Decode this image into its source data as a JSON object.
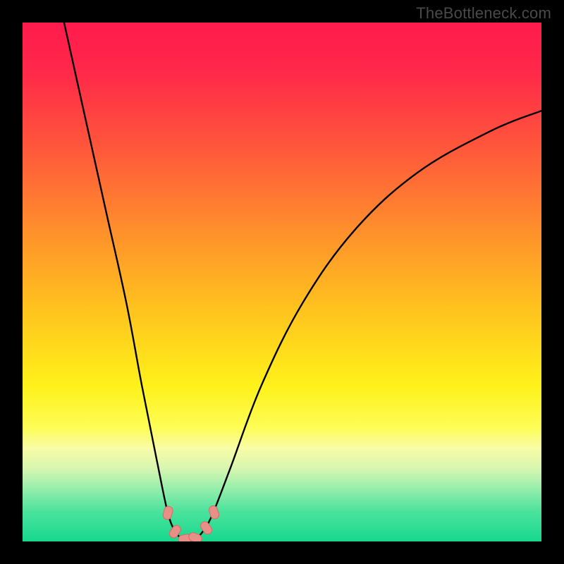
{
  "watermark": "TheBottleneck.com",
  "colors": {
    "frame": "#000000",
    "gradient_stops": [
      {
        "offset": 0.0,
        "color": "#ff1a4d"
      },
      {
        "offset": 0.1,
        "color": "#ff2a49"
      },
      {
        "offset": 0.25,
        "color": "#ff5a3a"
      },
      {
        "offset": 0.4,
        "color": "#ff8f2c"
      },
      {
        "offset": 0.55,
        "color": "#ffc21e"
      },
      {
        "offset": 0.7,
        "color": "#fff11a"
      },
      {
        "offset": 0.78,
        "color": "#fdfd55"
      },
      {
        "offset": 0.82,
        "color": "#f9fca6"
      },
      {
        "offset": 0.86,
        "color": "#d6f6b0"
      },
      {
        "offset": 0.9,
        "color": "#93edab"
      },
      {
        "offset": 0.94,
        "color": "#4ee39d"
      },
      {
        "offset": 1.0,
        "color": "#17d88e"
      }
    ],
    "curve_stroke": "#000000",
    "marker_fill": "#e88f87",
    "marker_stroke": "#d46c63"
  },
  "chart_data": {
    "type": "line",
    "title": "",
    "xlabel": "",
    "ylabel": "",
    "xlim": [
      0,
      100
    ],
    "ylim": [
      0,
      100
    ],
    "grid": false,
    "curve": {
      "left_branch": [
        {
          "x": 8.0,
          "y": 100.0
        },
        {
          "x": 12.0,
          "y": 82.0
        },
        {
          "x": 16.0,
          "y": 64.0
        },
        {
          "x": 20.0,
          "y": 46.0
        },
        {
          "x": 23.0,
          "y": 30.0
        },
        {
          "x": 26.0,
          "y": 15.0
        },
        {
          "x": 28.0,
          "y": 5.5
        },
        {
          "x": 29.5,
          "y": 1.8
        },
        {
          "x": 31.0,
          "y": 0.4
        }
      ],
      "right_branch": [
        {
          "x": 33.0,
          "y": 0.4
        },
        {
          "x": 34.5,
          "y": 1.6
        },
        {
          "x": 36.5,
          "y": 5.0
        },
        {
          "x": 40.0,
          "y": 14.0
        },
        {
          "x": 46.0,
          "y": 30.0
        },
        {
          "x": 54.0,
          "y": 46.0
        },
        {
          "x": 64.0,
          "y": 60.0
        },
        {
          "x": 76.0,
          "y": 71.0
        },
        {
          "x": 90.0,
          "y": 79.0
        },
        {
          "x": 100.0,
          "y": 83.0
        }
      ]
    },
    "markers": [
      {
        "x": 28.0,
        "y": 5.5,
        "angle": -76
      },
      {
        "x": 29.4,
        "y": 1.9,
        "angle": -55
      },
      {
        "x": 31.3,
        "y": 0.5,
        "angle": -12
      },
      {
        "x": 33.3,
        "y": 0.7,
        "angle": 22
      },
      {
        "x": 35.4,
        "y": 2.6,
        "angle": 55
      },
      {
        "x": 36.9,
        "y": 5.6,
        "angle": 72
      }
    ]
  }
}
